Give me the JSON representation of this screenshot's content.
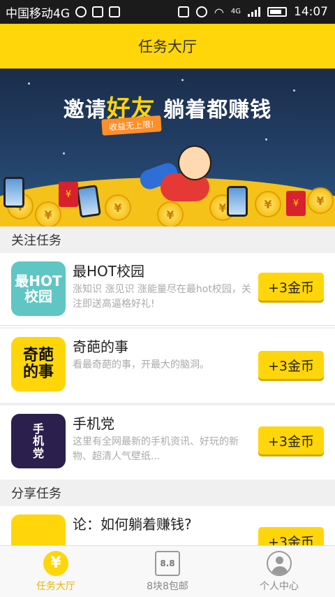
{
  "status_bar": {
    "carrier": "中国移动4G",
    "network": "4G",
    "time": "14:07"
  },
  "header": {
    "title": "任务大厅"
  },
  "banner": {
    "headline_pre": "邀请",
    "headline_big": "好友",
    "headline_post": " 躺着都赚钱",
    "badge": "收益无上限!",
    "coin_symbol": "¥",
    "redpack_symbol": "¥"
  },
  "sections": {
    "follow": "关注任务",
    "share": "分享任务"
  },
  "tasks": [
    {
      "thumb": "最HOT\n校园",
      "title": "最HOT校园",
      "desc": "涨知识 涨见识 涨能量尽在最hot校园，关注即送高逼格好礼!",
      "reward": "+3金币"
    },
    {
      "thumb": "奇葩\n的事",
      "title": "奇葩的事",
      "desc": "看最奇葩的事，开最大的脑洞。",
      "reward": "+3金币"
    },
    {
      "thumb": "手\n机\n党",
      "title": "手机党",
      "desc": "这里有全网最新的手机资讯、好玩的新物、超清人气壁纸...",
      "reward": "+3金币"
    },
    {
      "thumb": "",
      "title": "论：如何躺着赚钱?",
      "desc": "",
      "reward": "+3金币"
    }
  ],
  "tabbar": [
    {
      "label": "任务大厅",
      "icon": "yen-icon",
      "glyph": "¥"
    },
    {
      "label": "8块8包邮",
      "icon": "cart-icon",
      "glyph": "8.8"
    },
    {
      "label": "个人中心",
      "icon": "user-icon",
      "glyph": ""
    }
  ],
  "colors": {
    "accent": "#ffd60a",
    "active_tab": "#e6b800",
    "status_bar": "#1b1b1b"
  }
}
